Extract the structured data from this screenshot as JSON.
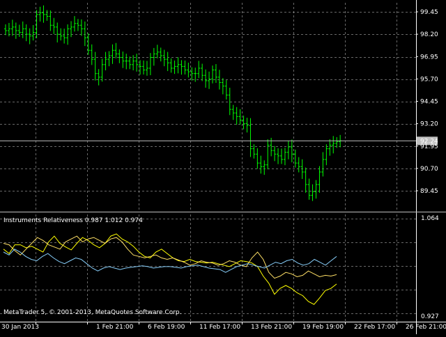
{
  "app": {
    "name": "MetaTrader 5",
    "copyright": "MetaTrader 5, © 2001-2013, MetaQuotes Software Corp."
  },
  "colors": {
    "background": "#000000",
    "grid": "#c0c0c0",
    "bullish": "#00ff00",
    "axis_text": "#ffffff",
    "bid_line": "#c0c0c0",
    "indicator_line_1": "#ffff00",
    "indicator_line_2": "#ffe066",
    "indicator_line_3": "#87cefa"
  },
  "price_axis": {
    "ticks": [
      "99.45",
      "98.20",
      "96.95",
      "95.70",
      "94.45",
      "93.20",
      "91.95",
      "90.70",
      "89.45"
    ],
    "current_price": "92.24"
  },
  "time_axis": {
    "labels": [
      "30 Jan 2013",
      "1 Feb 21:00",
      "6 Feb 19:00",
      "11 Feb 17:00",
      "13 Feb 21:00",
      "19 Feb 19:00",
      "22 Feb 17:00",
      "26 Feb 21:00"
    ]
  },
  "indicator": {
    "title": "Instruments Relativeness 0.987 1.012 0.974",
    "scale_max": "1.064",
    "scale_min": "0.927"
  },
  "chart_data": [
    {
      "type": "ohlc",
      "title": "",
      "ylim": [
        88.8,
        100.0
      ],
      "y_ticks": [
        99.45,
        98.2,
        96.95,
        95.7,
        94.45,
        93.2,
        91.95,
        90.7,
        89.45
      ],
      "current_price": 92.24,
      "x_labels": [
        "30 Jan 2013",
        "1 Feb 21:00",
        "6 Feb 19:00",
        "11 Feb 17:00",
        "13 Feb 21:00",
        "19 Feb 19:00",
        "22 Feb 17:00",
        "26 Feb 21:00"
      ],
      "close": [
        98.4,
        98.5,
        98.6,
        98.4,
        98.3,
        98.5,
        98.2,
        98.1,
        98.3,
        99.3,
        99.4,
        99.3,
        99.2,
        98.7,
        98.6,
        98.2,
        98.1,
        98.0,
        98.5,
        98.6,
        98.8,
        98.7,
        98.5,
        98.0,
        97.3,
        96.8,
        96.0,
        95.8,
        96.5,
        96.8,
        97.0,
        97.3,
        97.1,
        96.9,
        96.7,
        96.7,
        96.5,
        96.7,
        96.5,
        96.4,
        96.2,
        96.3,
        96.9,
        97.1,
        97.2,
        97.0,
        96.8,
        96.6,
        96.3,
        96.4,
        96.5,
        96.4,
        96.2,
        96.1,
        96.0,
        96.0,
        96.3,
        95.9,
        95.6,
        95.7,
        96.2,
        95.8,
        95.5,
        95.3,
        94.8,
        94.0,
        93.8,
        93.6,
        93.4,
        93.2,
        93.1,
        91.8,
        91.5,
        91.0,
        90.8,
        90.9,
        92.0,
        91.7,
        91.5,
        91.4,
        91.2,
        91.6,
        91.9,
        91.5,
        91.0,
        90.8,
        90.5,
        89.8,
        89.2,
        89.4,
        89.8,
        90.5,
        91.2,
        91.8,
        92.0,
        92.1,
        92.2,
        92.24
      ],
      "x_range": [
        "30 Jan 2013",
        "26 Feb 21:00+"
      ]
    },
    {
      "type": "line",
      "title": "Instruments Relativeness",
      "ylim": [
        0.927,
        1.064
      ],
      "series": [
        {
          "values": [
            1.022,
            1.016,
            1.028,
            1.028,
            1.024,
            1.026,
            1.022,
            1.018,
            1.032,
            1.04,
            1.03,
            1.025,
            1.021,
            1.03,
            1.038,
            1.034,
            1.028,
            1.024,
            1.03,
            1.04,
            1.043,
            1.036,
            1.032,
            1.026,
            1.018,
            1.012,
            1.01,
            1.018,
            1.022,
            1.016,
            1.01,
            1.006,
            1.005,
            1.008,
            1.005,
            1.004,
            1.003,
            1.004,
            1.002,
            1.0,
            0.998,
            1.002,
            1.006,
            1.005,
            1.003,
            0.998,
            0.985,
            0.975,
            0.96,
            0.968,
            0.972,
            0.968,
            0.962,
            0.958,
            0.95,
            0.946,
            0.955,
            0.965,
            0.968,
            0.974
          ]
        },
        {
          "values": [
            1.03,
            1.028,
            1.02,
            1.014,
            1.022,
            1.03,
            1.038,
            1.034,
            1.028,
            1.025,
            1.022,
            1.032,
            1.036,
            1.04,
            1.032,
            1.036,
            1.038,
            1.034,
            1.03,
            1.036,
            1.038,
            1.032,
            1.022,
            1.014,
            1.012,
            1.01,
            1.012,
            1.014,
            1.01,
            1.008,
            1.01,
            1.007,
            1.004,
            1.0,
            1.002,
            1.006,
            1.004,
            1.003,
            1.0,
            1.002,
            1.006,
            1.004,
            1.0,
            0.998,
            1.01,
            1.018,
            1.008,
            0.99,
            0.982,
            0.985,
            0.99,
            0.988,
            0.984,
            0.986,
            0.992,
            0.988,
            0.984,
            0.986,
            0.985,
            0.987
          ]
        },
        {
          "values": [
            1.018,
            1.014,
            1.022,
            1.018,
            1.012,
            1.008,
            1.006,
            1.012,
            1.016,
            1.01,
            1.005,
            1.002,
            1.006,
            1.01,
            1.008,
            1.002,
            0.996,
            0.992,
            0.996,
            0.998,
            0.996,
            0.994,
            0.996,
            0.997,
            0.998,
            0.999,
            0.998,
            0.996,
            0.997,
            0.998,
            0.998,
            0.997,
            0.996,
            0.998,
            0.999,
            1.0,
            0.998,
            0.996,
            0.995,
            0.994,
            0.99,
            0.994,
            0.998,
            1.0,
            1.002,
            1.0,
            0.998,
            0.996,
            1.0,
            1.004,
            1.002,
            1.006,
            1.008,
            1.003,
            1.0,
            1.002,
            1.008,
            1.004,
            1.0,
            1.006,
            1.012
          ]
        }
      ],
      "current_values": [
        0.987,
        1.012,
        0.974
      ]
    }
  ]
}
